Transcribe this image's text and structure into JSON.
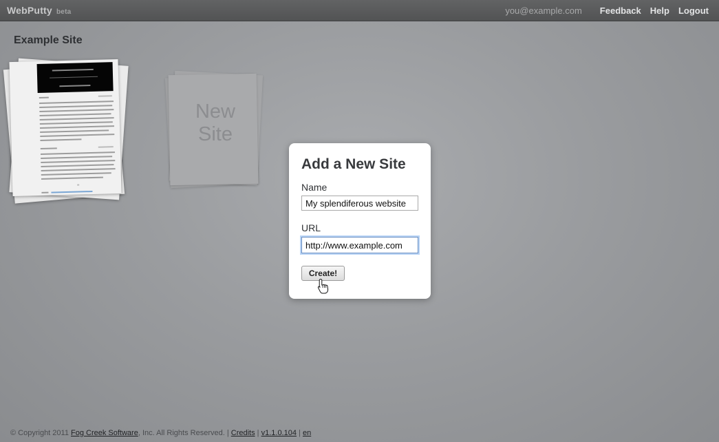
{
  "header": {
    "brand": "WebPutty",
    "beta": "beta",
    "email": "you@example.com",
    "links": [
      "Feedback",
      "Help",
      "Logout"
    ]
  },
  "site": {
    "title": "Example Site"
  },
  "new_site": {
    "label_line1": "New",
    "label_line2": "Site"
  },
  "modal": {
    "title": "Add a New Site",
    "name_label": "Name",
    "name_value": "My splendiferous website",
    "url_label": "URL",
    "url_value": "http://www.example.com",
    "submit_label": "Create!"
  },
  "footer": {
    "copyright_prefix": "© Copyright 2011 ",
    "company": "Fog Creek Software",
    "rights": ", Inc. All Rights Reserved. | ",
    "credits": "Credits",
    "sep1": " | ",
    "version": "v1.1.0.104",
    "sep2": " | ",
    "lang": "en"
  },
  "colors": {
    "topbar": "#5a5b5c",
    "background": "#9a9c9f",
    "focus_ring": "#b9d4f5"
  },
  "icons": {
    "cursor": "hand-pointer-icon"
  }
}
